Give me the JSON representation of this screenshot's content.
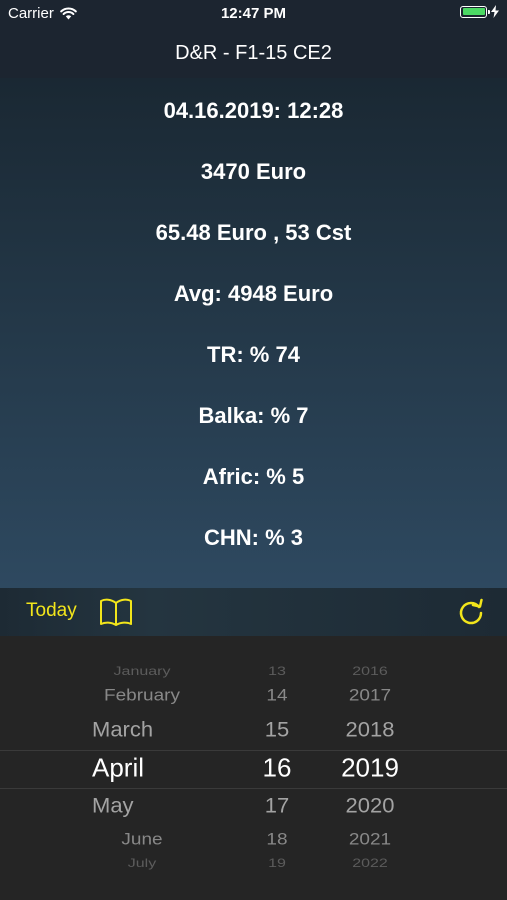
{
  "status": {
    "carrier": "Carrier",
    "time": "12:47 PM",
    "battery_level": 1.0,
    "battery_color": "#4cd964"
  },
  "nav": {
    "title": "D&R - F1-15 CE2"
  },
  "stats": [
    "04.16.2019: 12:28",
    "3470 Euro",
    "65.48 Euro , 53 Cst",
    "Avg: 4948 Euro",
    "TR: % 74",
    "Balka: % 7",
    "Afric: % 5",
    "CHN: % 3"
  ],
  "toolbar": {
    "today_label": "Today",
    "accent_color": "#f2e51b",
    "book_icon": "book-icon",
    "refresh_icon": "refresh-icon"
  },
  "picker": {
    "months": [
      "January",
      "February",
      "March",
      "April",
      "May",
      "June",
      "July"
    ],
    "days": [
      "13",
      "14",
      "15",
      "16",
      "17",
      "18",
      "19"
    ],
    "years": [
      "2016",
      "2017",
      "2018",
      "2019",
      "2020",
      "2021",
      "2022"
    ],
    "selected": {
      "month": "April",
      "day": "16",
      "year": "2019"
    }
  }
}
